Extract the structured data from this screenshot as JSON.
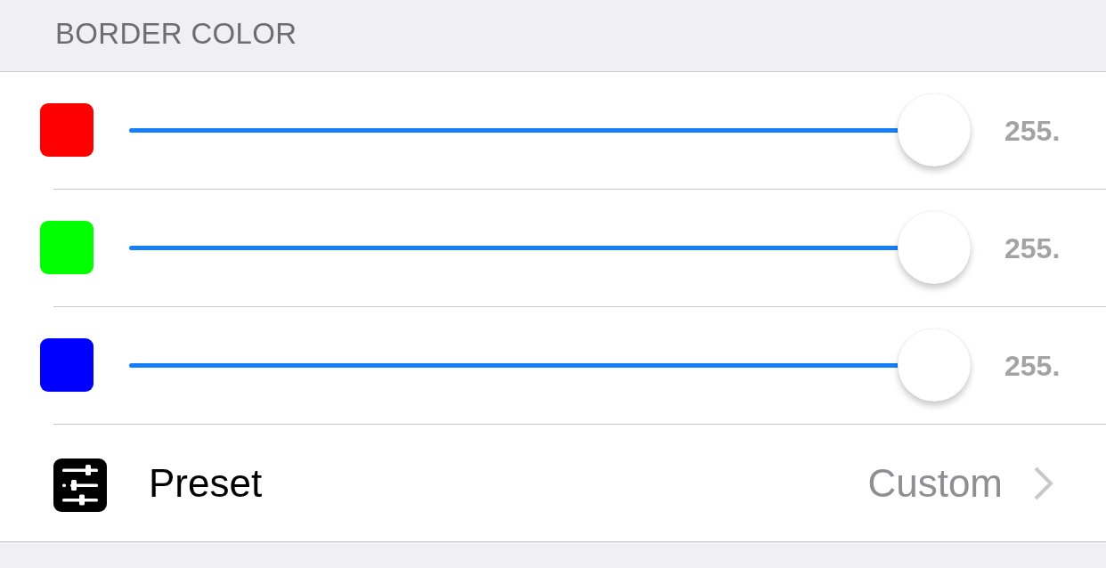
{
  "section": {
    "title": "BORDER COLOR"
  },
  "sliders": [
    {
      "color": "#ff0000",
      "level": 1,
      "reading": "255."
    },
    {
      "color": "#00ff00",
      "level": 1,
      "reading": "255."
    },
    {
      "color": "#0000ff",
      "level": 1,
      "reading": "255."
    }
  ],
  "preset": {
    "label": "Preset",
    "value": "Custom"
  }
}
